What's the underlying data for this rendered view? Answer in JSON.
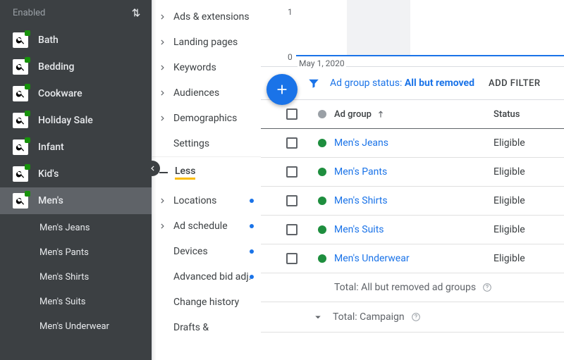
{
  "sidebar": {
    "header": "Enabled",
    "items": [
      {
        "label": "Bath"
      },
      {
        "label": "Bedding"
      },
      {
        "label": "Cookware"
      },
      {
        "label": "Holiday Sale"
      },
      {
        "label": "Infant"
      },
      {
        "label": "Kid's"
      },
      {
        "label": "Men's",
        "selected": true
      }
    ],
    "subitems": [
      "Men's Jeans",
      "Men's Pants",
      "Men's Shirts",
      "Men's Suits",
      "Men's Underwear"
    ]
  },
  "midnav": {
    "group1": [
      "Ads & extensions",
      "Landing pages",
      "Keywords",
      "Audiences",
      "Demographics"
    ],
    "settings": "Settings",
    "less": "Less",
    "group2": [
      {
        "label": "Locations",
        "expandable": true,
        "dot": true
      },
      {
        "label": "Ad schedule",
        "expandable": true,
        "dot": true
      },
      {
        "label": "Devices",
        "expandable": false,
        "dot": true
      },
      {
        "label": "Advanced bid adj.",
        "expandable": false,
        "dot": true
      },
      {
        "label": "Change history",
        "expandable": false,
        "dot": false
      },
      {
        "label": "Drafts &",
        "expandable": false,
        "dot": false
      }
    ]
  },
  "chart_data": {
    "type": "line",
    "x": [
      "May 1, 2020"
    ],
    "values": [
      0
    ],
    "ylim": [
      0,
      1
    ],
    "yticks": [
      "0",
      "1"
    ],
    "xlabel_shown": "May 1, 2020"
  },
  "filter": {
    "label": "Ad group status:",
    "value": "All but removed",
    "add": "ADD FILTER"
  },
  "table": {
    "columns": {
      "name": "Ad group",
      "status": "Status"
    },
    "rows": [
      {
        "name": "Men's Jeans",
        "status": "Eligible"
      },
      {
        "name": "Men's Pants",
        "status": "Eligible"
      },
      {
        "name": "Men's Shirts",
        "status": "Eligible"
      },
      {
        "name": "Men's Suits",
        "status": "Eligible"
      },
      {
        "name": "Men's Underwear",
        "status": "Eligible"
      }
    ],
    "totals": {
      "allbutremoved": "Total: All but removed ad groups",
      "campaign": "Total: Campaign"
    }
  }
}
